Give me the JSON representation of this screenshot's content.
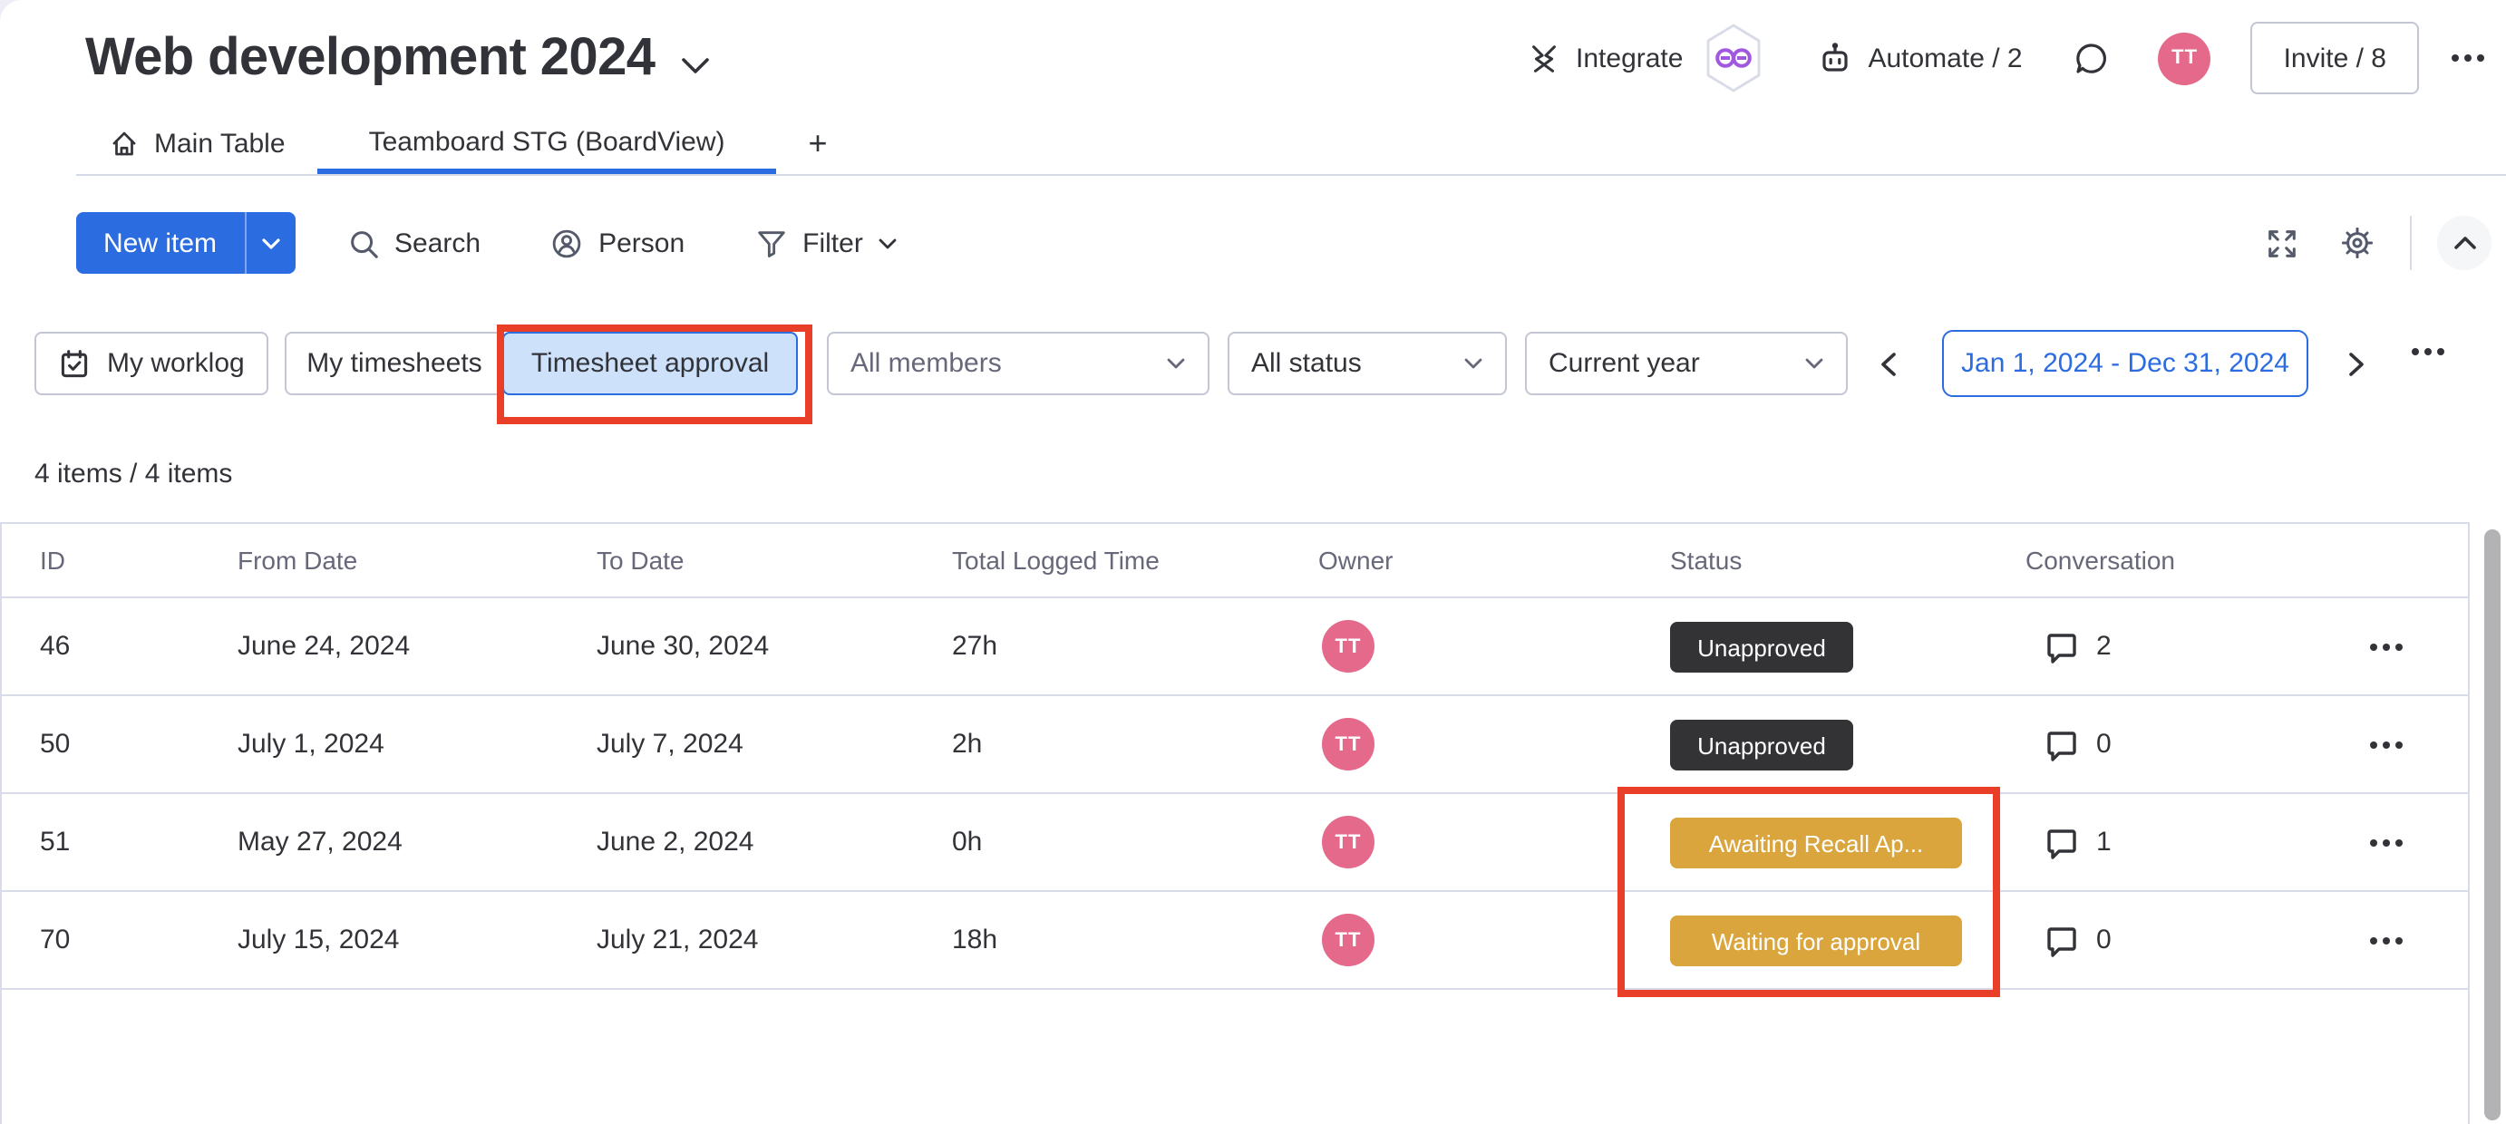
{
  "board": {
    "title": "Web development 2024"
  },
  "top_actions": {
    "integrate": "Integrate",
    "automate": "Automate / 2",
    "invite": "Invite / 8",
    "avatar_initials": "TT"
  },
  "tabs": {
    "main_table": "Main Table",
    "board_view": "Teamboard STG (BoardView)",
    "add_tab": "+"
  },
  "toolbar": {
    "new_item": "New item",
    "search": "Search",
    "person": "Person",
    "filter": "Filter"
  },
  "filters": {
    "my_worklog": "My worklog",
    "my_timesheets": "My timesheets",
    "timesheet_approval": "Timesheet approval",
    "all_members": "All members",
    "all_status": "All status",
    "current_year": "Current year",
    "date_range": "Jan 1, 2024 - Dec 31, 2024"
  },
  "summary": {
    "items_count": "4 items / 4 items"
  },
  "table": {
    "columns": {
      "id": "ID",
      "from": "From Date",
      "to": "To Date",
      "time": "Total Logged Time",
      "owner": "Owner",
      "status": "Status",
      "conversation": "Conversation"
    },
    "rows": [
      {
        "id": "46",
        "from": "June 24, 2024",
        "to": "June 30, 2024",
        "time": "27h",
        "owner": "TT",
        "status": "Unapproved",
        "conversations": "2"
      },
      {
        "id": "50",
        "from": "July 1, 2024",
        "to": "July 7, 2024",
        "time": "2h",
        "owner": "TT",
        "status": "Unapproved",
        "conversations": "0"
      },
      {
        "id": "51",
        "from": "May 27, 2024",
        "to": "June 2, 2024",
        "time": "0h",
        "owner": "TT",
        "status": "Awaiting Recall Ap...",
        "conversations": "1"
      },
      {
        "id": "70",
        "from": "July 15, 2024",
        "to": "July 21, 2024",
        "time": "18h",
        "owner": "TT",
        "status": "Waiting for approval",
        "conversations": "0"
      }
    ]
  },
  "colors": {
    "accent_blue": "#2b6ce0",
    "status_dark": "#333336",
    "status_gold": "#d9a53c",
    "avatar_pink": "#e5698a",
    "annotation_red": "#e93e27",
    "text_primary": "#323338",
    "text_secondary": "#676879"
  }
}
